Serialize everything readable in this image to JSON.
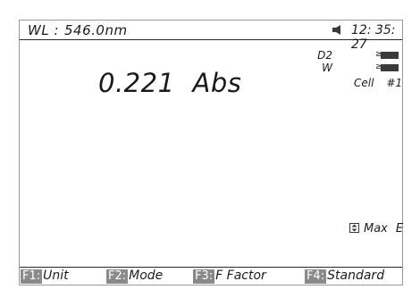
{
  "status": {
    "wavelength_label": "WL :",
    "wavelength_value": "546.0nm",
    "speaker_icon": "speaker-icon",
    "time": "12: 35: 27"
  },
  "measurement": {
    "value": "0.221",
    "unit": "Abs"
  },
  "lamps": [
    {
      "label": "D2",
      "icon": "lamp-indicator-icon"
    },
    {
      "label": "W",
      "icon": "lamp-indicator-icon"
    }
  ],
  "cell": {
    "label": "Cell",
    "number": "#1"
  },
  "max": {
    "icon": "updown-arrow-icon",
    "label": "Max",
    "suffix": "E"
  },
  "function_keys": [
    {
      "key": "F1:",
      "label": "Unit"
    },
    {
      "key": "F2:",
      "label": "Mode"
    },
    {
      "key": "F3:",
      "label": "F Factor"
    },
    {
      "key": "F4:",
      "label": "Standard"
    }
  ],
  "colors": {
    "background": "#ffffff",
    "text": "#1c1c1c",
    "key_badge": "#8a8a8a"
  }
}
